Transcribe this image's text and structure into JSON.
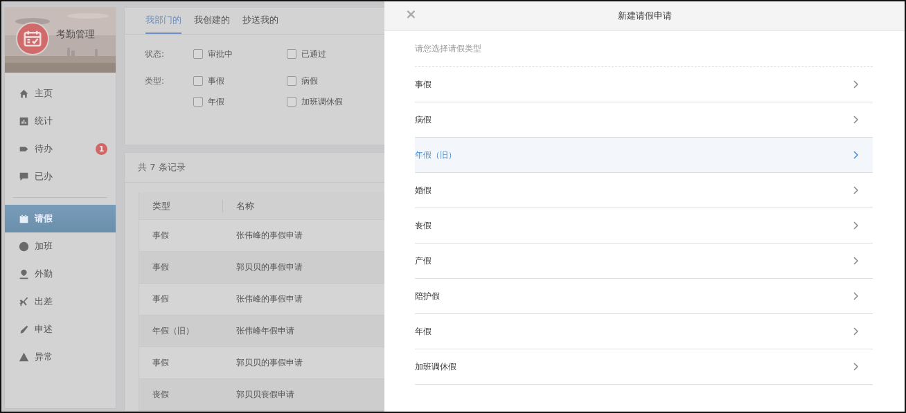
{
  "app": {
    "title": "考勤管理"
  },
  "sidebar": {
    "items": [
      {
        "label": "主页",
        "selected": false
      },
      {
        "label": "统计",
        "selected": false
      },
      {
        "label": "待办",
        "selected": false,
        "badge": "1"
      },
      {
        "label": "已办",
        "selected": false
      },
      {
        "label": "请假",
        "selected": true
      },
      {
        "label": "加班",
        "selected": false
      },
      {
        "label": "外勤",
        "selected": false
      },
      {
        "label": "出差",
        "selected": false
      },
      {
        "label": "申述",
        "selected": false
      },
      {
        "label": "异常",
        "selected": false
      }
    ]
  },
  "tabs": [
    {
      "label": "我部门的",
      "selected": true
    },
    {
      "label": "我创建的",
      "selected": false
    },
    {
      "label": "抄送我的",
      "selected": false
    }
  ],
  "filters": [
    {
      "label": "状态:",
      "options": [
        {
          "label": "审批中",
          "checked": false
        },
        {
          "label": "已通过",
          "checked": false
        }
      ]
    },
    {
      "label": "类型:",
      "options": [
        {
          "label": "事假",
          "checked": false
        },
        {
          "label": "病假",
          "checked": false
        },
        {
          "label": "年假",
          "checked": false
        },
        {
          "label": "加班调休假",
          "checked": false
        }
      ]
    }
  ],
  "record_count": "共 7 条记录",
  "table": {
    "columns": [
      "类型",
      "名称"
    ],
    "rows": [
      [
        "事假",
        "张伟峰的事假申请"
      ],
      [
        "事假",
        "郭贝贝的事假申请"
      ],
      [
        "事假",
        "张伟峰的事假申请"
      ],
      [
        "年假（旧）",
        "张伟峰年假申请"
      ],
      [
        "事假",
        "郭贝贝的事假申请"
      ],
      [
        "丧假",
        "郭贝贝丧假申请"
      ]
    ]
  },
  "drawer": {
    "title": "新建请假申请",
    "close": "×",
    "prompt": "请您选择请假类型",
    "options": [
      {
        "label": "事假",
        "selected": false
      },
      {
        "label": "病假",
        "selected": false
      },
      {
        "label": "年假（旧）",
        "selected": true
      },
      {
        "label": "婚假",
        "selected": false
      },
      {
        "label": "丧假",
        "selected": false
      },
      {
        "label": "产假",
        "selected": false
      },
      {
        "label": "陪护假",
        "selected": false
      },
      {
        "label": "年假",
        "selected": false
      },
      {
        "label": "加班调休假",
        "selected": false
      }
    ]
  }
}
